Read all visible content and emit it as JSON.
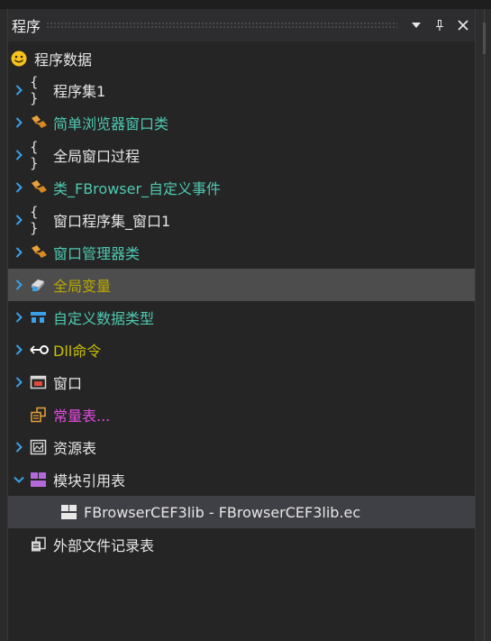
{
  "panel": {
    "title": "程序",
    "buttons": {
      "dropdown_icon": "caret-down-icon",
      "pin_icon": "pin-icon",
      "close_icon": "close-icon"
    }
  },
  "tree": {
    "root_label": "程序数据",
    "items": [
      {
        "label": "程序集1",
        "icon": "braces-icon"
      },
      {
        "label": "简单浏览器窗口类",
        "icon": "class-icon"
      },
      {
        "label": "全局窗口过程",
        "icon": "braces-icon"
      },
      {
        "label": "类_FBrowser_自定义事件",
        "icon": "class-icon"
      },
      {
        "label": "窗口程序集_窗口1",
        "icon": "braces-icon"
      },
      {
        "label": "窗口管理器类",
        "icon": "class-icon"
      },
      {
        "label": "全局变量",
        "icon": "global-variable-icon"
      },
      {
        "label": "自定义数据类型",
        "icon": "data-type-icon"
      },
      {
        "label": "Dll命令",
        "icon": "dll-icon"
      },
      {
        "label": "窗口",
        "icon": "window-icon"
      },
      {
        "label": "常量表...",
        "icon": "constant-icon"
      },
      {
        "label": "资源表",
        "icon": "resource-icon"
      },
      {
        "label": "模块引用表",
        "icon": "module-icon"
      },
      {
        "label": "FBrowserCEF3lib - FBrowserCEF3lib.ec",
        "icon": "module-file-icon"
      },
      {
        "label": "外部文件记录表",
        "icon": "external-file-icon"
      }
    ]
  },
  "colors": {
    "teal": "#4ec9b0",
    "olive": "#b8a800",
    "pink": "#e24ce0",
    "chevron": "#3aa0e8",
    "highlight": "#4d4d4d"
  }
}
